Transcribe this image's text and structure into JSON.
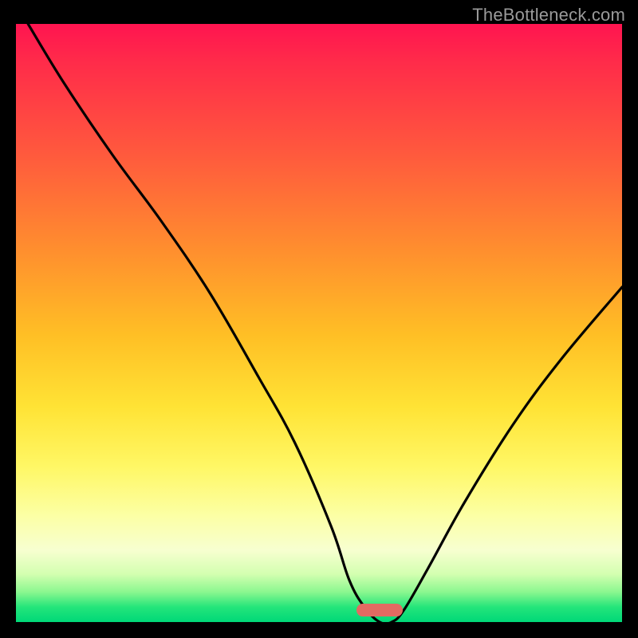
{
  "watermark": "TheBottleneck.com",
  "chart_data": {
    "type": "line",
    "title": "",
    "xlabel": "",
    "ylabel": "",
    "xlim": [
      0,
      100
    ],
    "ylim": [
      0,
      100
    ],
    "grid": false,
    "legend": false,
    "background_gradient": {
      "stops": [
        {
          "pos": 0.0,
          "color": "#ff1450"
        },
        {
          "pos": 0.06,
          "color": "#ff2a4a"
        },
        {
          "pos": 0.22,
          "color": "#ff5a3d"
        },
        {
          "pos": 0.38,
          "color": "#ff8f2e"
        },
        {
          "pos": 0.52,
          "color": "#ffbf25"
        },
        {
          "pos": 0.64,
          "color": "#ffe335"
        },
        {
          "pos": 0.74,
          "color": "#fff765"
        },
        {
          "pos": 0.82,
          "color": "#fcffa3"
        },
        {
          "pos": 0.88,
          "color": "#f7ffd0"
        },
        {
          "pos": 0.92,
          "color": "#d3ffb0"
        },
        {
          "pos": 0.95,
          "color": "#8af78f"
        },
        {
          "pos": 0.975,
          "color": "#24e57a"
        },
        {
          "pos": 1.0,
          "color": "#00d878"
        }
      ]
    },
    "series": [
      {
        "name": "bottleneck-curve",
        "color": "#000000",
        "x": [
          2,
          8,
          16,
          24,
          32,
          40,
          46,
          52,
          55,
          57.5,
          60,
          62,
          64,
          68,
          74,
          82,
          90,
          100
        ],
        "y": [
          100,
          90,
          78,
          67,
          55,
          41,
          30,
          16,
          7,
          2.5,
          0,
          0,
          2,
          9,
          20,
          33,
          44,
          56
        ]
      }
    ],
    "marker": {
      "name": "optimum-marker",
      "shape": "pill",
      "color": "#e26a62",
      "x_center": 60,
      "y_center": 2,
      "width_pct": 7.6,
      "height_pct": 2.1
    }
  }
}
